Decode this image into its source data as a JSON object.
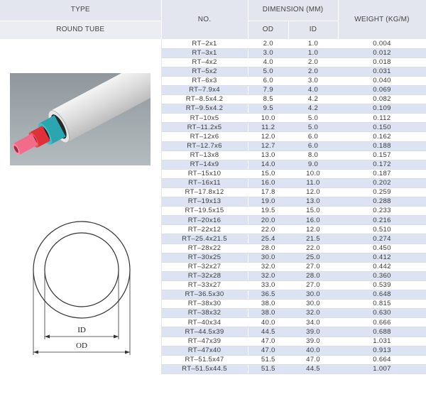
{
  "header": {
    "type_label": "TYPE",
    "no_label": "NO.",
    "dimension_label": "DIMENSION (MM)",
    "weight_label": "WEIGHT   (KG/M)",
    "od_label": "OD",
    "id_label": "ID",
    "category": "ROUND TUBE"
  },
  "diagram": {
    "id_label": "ID",
    "od_label": "OD"
  },
  "photo": {
    "icon": "tube-photo"
  },
  "rows": [
    {
      "no": "RT–2x1",
      "od": "2.0",
      "id": "1.0",
      "weight": "0.004"
    },
    {
      "no": "RT–3x1",
      "od": "3.0",
      "id": "1.0",
      "weight": "0.012"
    },
    {
      "no": "RT–4x2",
      "od": "4.0",
      "id": "2.0",
      "weight": "0.018"
    },
    {
      "no": "RT–5x2",
      "od": "5.0",
      "id": "2.0",
      "weight": "0.031"
    },
    {
      "no": "RT–6x3",
      "od": "6.0",
      "id": "3.0",
      "weight": "0.040"
    },
    {
      "no": "RT–7.9x4",
      "od": "7.9",
      "id": "4.0",
      "weight": "0.069"
    },
    {
      "no": "RT–8.5x4.2",
      "od": "8.5",
      "id": "4.2",
      "weight": "0.082"
    },
    {
      "no": "RT–9.5x4.2",
      "od": "9.5",
      "id": "4.2",
      "weight": "0.109"
    },
    {
      "no": "RT–10x5",
      "od": "10.0",
      "id": "5.0",
      "weight": "0.112"
    },
    {
      "no": "RT–11.2x5",
      "od": "11.2",
      "id": "5.0",
      "weight": "0.150"
    },
    {
      "no": "RT–12x6",
      "od": "12.0",
      "id": "6.0",
      "weight": "0.162"
    },
    {
      "no": "RT–12.7x6",
      "od": "12.7",
      "id": "6.0",
      "weight": "0.188"
    },
    {
      "no": "RT–13x8",
      "od": "13.0",
      "id": "8.0",
      "weight": "0.157"
    },
    {
      "no": "RT–14x9",
      "od": "14.0",
      "id": "9.0",
      "weight": "0.172"
    },
    {
      "no": "RT–15x10",
      "od": "15.0",
      "id": "10.0",
      "weight": "0.187"
    },
    {
      "no": "RT–16x11",
      "od": "16.0",
      "id": "11.0",
      "weight": "0.202"
    },
    {
      "no": "RT–17.8x12",
      "od": "17.8",
      "id": "12.0",
      "weight": "0.259"
    },
    {
      "no": "RT–19x13",
      "od": "19.0",
      "id": "13.0",
      "weight": "0.288"
    },
    {
      "no": "RT–19.5x15",
      "od": "19.5",
      "id": "15.0",
      "weight": "0.233"
    },
    {
      "no": "RT–20x16",
      "od": "20.0",
      "id": "16.0",
      "weight": "0.216"
    },
    {
      "no": "RT–22x12",
      "od": "22.0",
      "id": "12.0",
      "weight": "0.510"
    },
    {
      "no": "RT–25.4x21.5",
      "od": "25.4",
      "id": "21.5",
      "weight": "0.274"
    },
    {
      "no": "RT–28x22",
      "od": "28.0",
      "id": "22.0",
      "weight": "0.450"
    },
    {
      "no": "RT–30x25",
      "od": "30.0",
      "id": "25.0",
      "weight": "0.412"
    },
    {
      "no": "RT–32x27",
      "od": "32.0",
      "id": "27.0",
      "weight": "0.442"
    },
    {
      "no": "RT–32x28",
      "od": "32.0",
      "id": "28.0",
      "weight": "0.360"
    },
    {
      "no": "RT–33x27",
      "od": "33.0",
      "id": "27.0",
      "weight": "0.539"
    },
    {
      "no": "RT–36.5x30",
      "od": "36.5",
      "id": "30.0",
      "weight": "0.648"
    },
    {
      "no": "RT–38x30",
      "od": "38.0",
      "id": "30.0",
      "weight": "0.815"
    },
    {
      "no": "RT–38x32",
      "od": "38.0",
      "id": "32.0",
      "weight": "0.630"
    },
    {
      "no": "RT–40x34",
      "od": "40.0",
      "id": "34.0",
      "weight": "0.666"
    },
    {
      "no": "RT–44.5x39",
      "od": "44.5",
      "id": "39.0",
      "weight": "0.688"
    },
    {
      "no": "RT–47x39",
      "od": "47.0",
      "id": "39.0",
      "weight": "1.031"
    },
    {
      "no": "RT–47x40",
      "od": "47.0",
      "id": "40.0",
      "weight": "0.913"
    },
    {
      "no": "RT–51.5x47",
      "od": "51.5",
      "id": "47.0",
      "weight": "0.664"
    },
    {
      "no": "RT–51.5x44.5",
      "od": "51.5",
      "id": "44.5",
      "weight": "1.007"
    }
  ]
}
